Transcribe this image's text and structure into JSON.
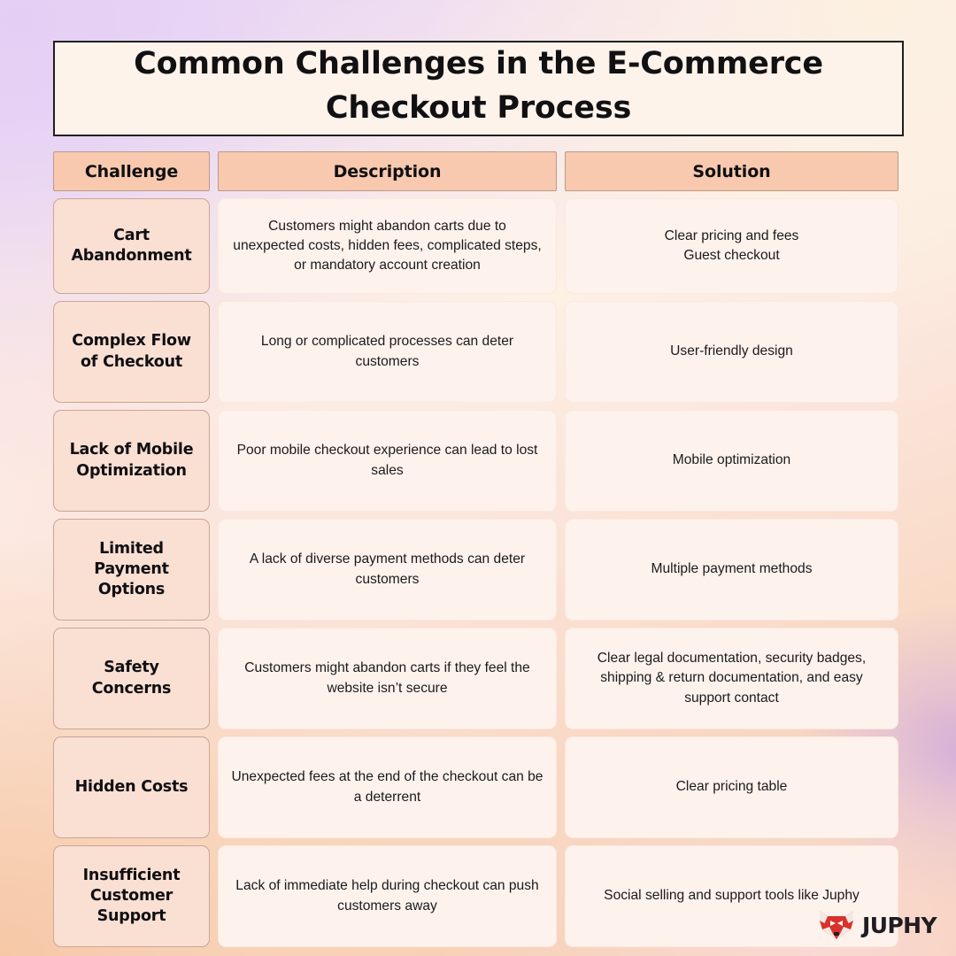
{
  "title": {
    "line1": "Common Challenges in the E-Commerce",
    "line2": "Checkout Process"
  },
  "table": {
    "headers": {
      "challenge": "Challenge",
      "description": "Description",
      "solution": "Solution"
    },
    "rows": [
      {
        "challenge": "Cart Abandonment",
        "description": "Customers might abandon carts due to unexpected costs, hidden fees, complicated steps, or mandatory account creation",
        "solution": "Clear pricing and fees\nGuest checkout"
      },
      {
        "challenge": "Complex Flow of Checkout",
        "description": "Long or complicated processes can deter customers",
        "solution": "User-friendly design"
      },
      {
        "challenge": "Lack of Mobile Optimization",
        "description": "Poor mobile checkout experience can lead to lost sales",
        "solution": "Mobile optimization"
      },
      {
        "challenge": "Limited Payment Options",
        "description": "A lack of diverse payment methods can deter customers",
        "solution": "Multiple payment methods"
      },
      {
        "challenge": "Safety Concerns",
        "description": "Customers might abandon carts if they feel the website isn’t secure",
        "solution": "Clear legal documentation, security badges, shipping & return documentation, and easy support contact"
      },
      {
        "challenge": "Hidden Costs",
        "description": "Unexpected fees at the end of the checkout can be a deterrent",
        "solution": "Clear pricing table"
      },
      {
        "challenge": "Insufficient Customer Support",
        "description": "Lack of immediate help during checkout can push customers away",
        "solution": "Social selling and support tools like Juphy"
      }
    ]
  },
  "footer": {
    "brand": "JUPHY",
    "logo_icon": "fox-head-icon"
  },
  "colors": {
    "title_border": "#231f20",
    "title_fill": "#fdf3ea",
    "header_fill": "#f8c9ae",
    "challenge_fill": "#fadfd3",
    "body_fill": "#fdf2ec",
    "text": "#100f12",
    "logo_red": "#d8322b",
    "background_top_left": "#ead7f5",
    "background_bottom_left": "#f5c9a8",
    "background_top_right": "#fdf1e4",
    "background_accent_violet": "#c9a2e2"
  }
}
